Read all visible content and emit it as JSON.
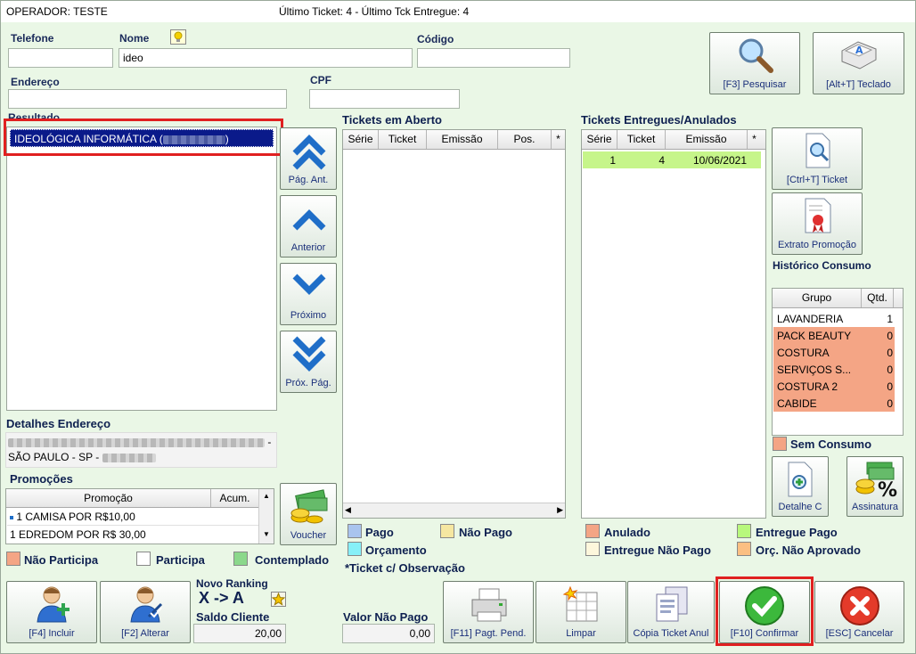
{
  "titlebar": {
    "operator": "OPERADOR: TESTE",
    "tickets": "Último Ticket: 4  - Último Tck Entregue: 4"
  },
  "form": {
    "telefone_label": "Telefone",
    "telefone_value": "",
    "nome_label": "Nome",
    "nome_value": "ideo",
    "codigo_label": "Código",
    "codigo_value": "",
    "endereco_label": "Endereço",
    "endereco_value": "",
    "cpf_label": "CPF",
    "cpf_value": ""
  },
  "top_buttons": {
    "pesquisar": "[F3] Pesquisar",
    "teclado": "[Alt+T] Teclado"
  },
  "resultado": {
    "label": "Resultado",
    "selected_item": "IDEOLÓGICA INFORMÁTICA (",
    "selected_suffix": ")"
  },
  "nav": {
    "pag_ant": "Pág. Ant.",
    "anterior": "Anterior",
    "proximo": "Próximo",
    "prox_pag": "Próx. Pág."
  },
  "tickets_aberto": {
    "title": "Tickets em Aberto",
    "columns": [
      "Série",
      "Ticket",
      "Emissão",
      "Pos.",
      "*"
    ]
  },
  "tickets_entregues": {
    "title": "Tickets Entregues/Anulados",
    "columns": [
      "Série",
      "Ticket",
      "Emissão",
      "*"
    ],
    "rows": [
      {
        "serie": "1",
        "ticket": "4",
        "emissao": "10/06/2021"
      }
    ]
  },
  "side_buttons": {
    "ticket": "[Ctrl+T] Ticket",
    "extrato": "Extrato Promoção"
  },
  "historico": {
    "title": "Histórico Consumo",
    "columns": [
      "Grupo",
      "Qtd."
    ],
    "rows": [
      {
        "grupo": "LAVANDERIA",
        "qtd": "1",
        "color": "#ffffff"
      },
      {
        "grupo": "PACK BEAUTY",
        "qtd": "0",
        "color": "#f4a585"
      },
      {
        "grupo": "COSTURA",
        "qtd": "0",
        "color": "#f4a585"
      },
      {
        "grupo": "SERVIÇOS  S...",
        "qtd": "0",
        "color": "#f4a585"
      },
      {
        "grupo": "COSTURA 2",
        "qtd": "0",
        "color": "#f4a585"
      },
      {
        "grupo": "CABIDE",
        "qtd": "0",
        "color": "#f4a585"
      }
    ],
    "sem_consumo": "Sem Consumo"
  },
  "detalhes": {
    "title": "Detalhes Endereço",
    "line1_suffix": "-",
    "line2": "SÃO PAULO - SP -"
  },
  "promocoes": {
    "title": "Promoções",
    "columns": [
      "Promoção",
      "Acum."
    ],
    "rows": [
      {
        "promocao": "1 CAMISA POR R$10,00",
        "acum": ""
      },
      {
        "promocao": "1 EDREDOM POR R$ 30,00",
        "acum": ""
      }
    ],
    "voucher": "Voucher"
  },
  "legend_promo": {
    "nao_participa": "Não Participa",
    "participa": "Participa",
    "contemplado": "Contemplado"
  },
  "legend_tickets": {
    "pago": "Pago",
    "nao_pago": "Não Pago",
    "orcamento": "Orçamento",
    "obs": "*Ticket c/ Observação"
  },
  "legend_entregues": {
    "anulado": "Anulado",
    "entregue_nao_pago": "Entregue Não Pago",
    "entregue_pago": "Entregue Pago",
    "orc_nao_aprovado": "Orç. Não Aprovado"
  },
  "bottom_right_small": {
    "detalhe": "Detalhe C",
    "assinatura": "Assinatura"
  },
  "bottom": {
    "incluir": "[F4] Incluir",
    "alterar": "[F2] Alterar",
    "novo_ranking": "Novo Ranking",
    "ranking_value": "X -> A",
    "saldo_label": "Saldo Cliente",
    "saldo_value": "20,00",
    "valor_nao_pago_label": "Valor Não Pago",
    "valor_nao_pago_value": "0,00",
    "pagt_pend": "[F11] Pagt. Pend.",
    "limpar": "Limpar",
    "copia": "Cópia Ticket Anul",
    "confirmar": "[F10] Confirmar",
    "cancelar": "[ESC] Cancelar"
  },
  "colors": {
    "pago": "#a9c4ee",
    "nao_pago": "#f6e7a1",
    "orcamento": "#86f0f8",
    "anulado": "#f4a585",
    "entregue_nao_pago": "#fdf7dc",
    "entregue_pago": "#b8f87c",
    "orc_nao_aprovado": "#fbbf82",
    "nao_participa": "#f4a585",
    "participa": "#ffffff",
    "contemplado": "#8bd88b",
    "selection": "#0a1a8a",
    "highlight_row": "#c6f58a"
  }
}
